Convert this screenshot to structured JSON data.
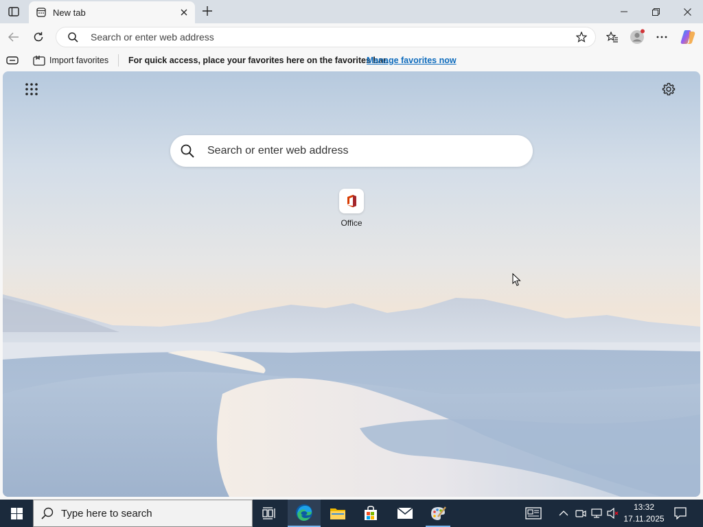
{
  "browser": {
    "tab": {
      "title": "New tab"
    },
    "omnibox": {
      "placeholder": "Search or enter web address"
    }
  },
  "favorites_bar": {
    "import_label": "Import favorites",
    "message": "For quick access, place your favorites here on the favorites bar.",
    "link_label": "Manage favorites now"
  },
  "new_tab_page": {
    "search_placeholder": "Search or enter web address",
    "quick_links": [
      {
        "label": "Office",
        "icon": "office-icon"
      }
    ]
  },
  "taskbar": {
    "search_placeholder": "Type here to search",
    "apps": [
      "task-view-icon",
      "edge-icon",
      "file-explorer-icon",
      "store-icon",
      "mail-icon",
      "paint-icon"
    ],
    "clock": {
      "time": "13:32",
      "date": "17.11.2025"
    }
  },
  "colors": {
    "accent_link": "#0f6cbd",
    "taskbar_bg": "#1b2a3c",
    "tabstrip_bg": "#d9dfe6"
  }
}
